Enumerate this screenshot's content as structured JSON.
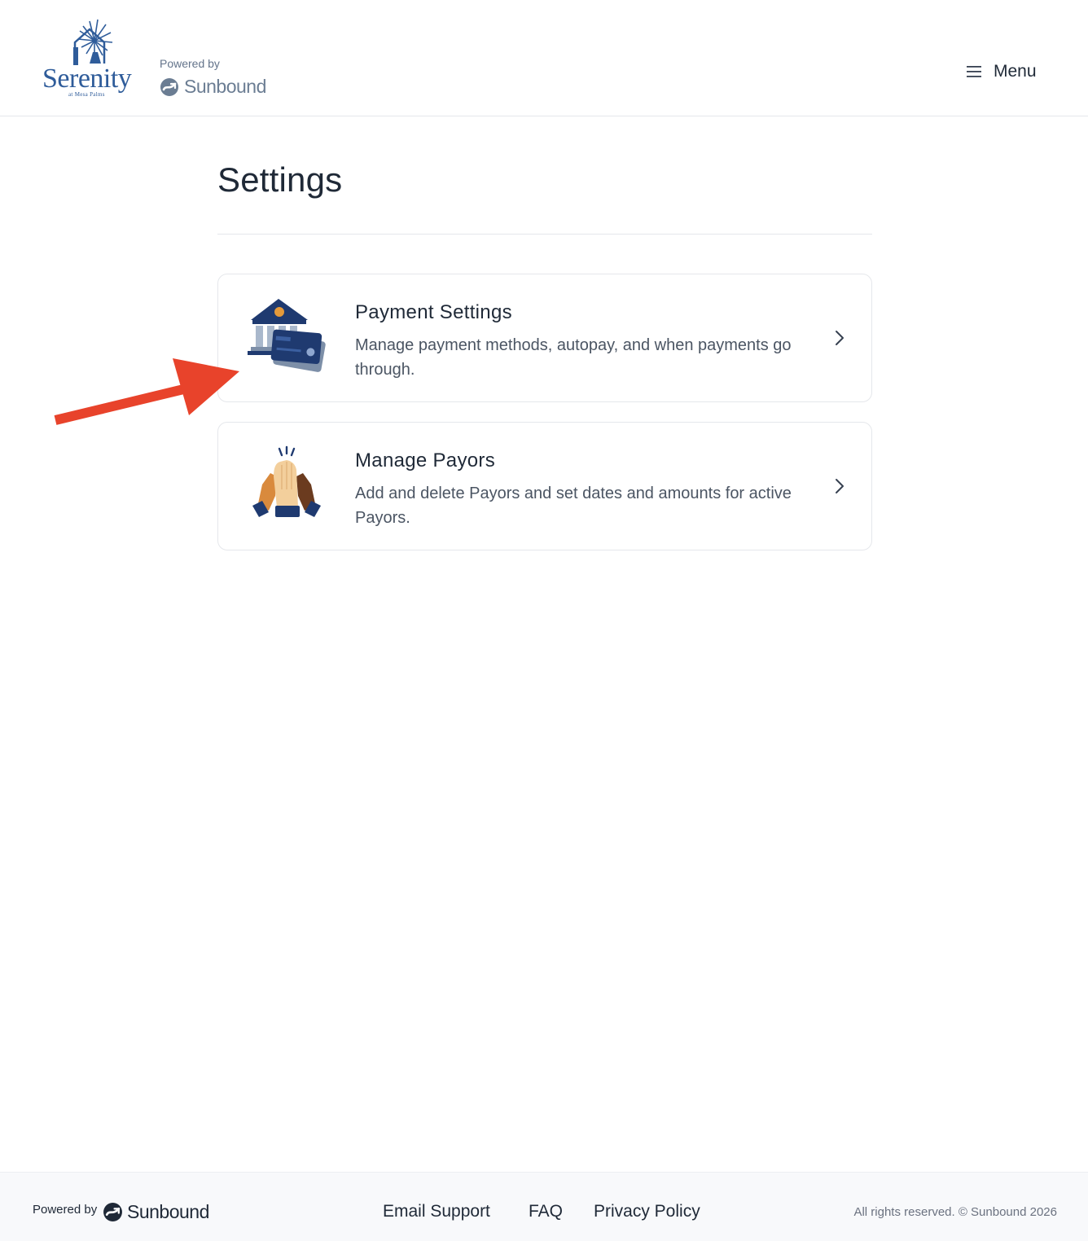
{
  "header": {
    "brand_name": "Serenity",
    "brand_subtitle": "at Mesa Palms",
    "powered_by": "Powered by",
    "platform_name": "Sunbound",
    "menu_label": "Menu"
  },
  "main": {
    "title": "Settings",
    "cards": [
      {
        "icon": "bank-card-icon",
        "title": "Payment Settings",
        "description": "Manage payment methods, autopay, and when payments go through."
      },
      {
        "icon": "high-five-icon",
        "title": "Manage Payors",
        "description": "Add and delete Payors and set dates and amounts for active Payors."
      }
    ]
  },
  "footer": {
    "powered_by": "Powered by",
    "platform_name": "Sunbound",
    "links": [
      "Email Support",
      "FAQ",
      "Privacy Policy"
    ],
    "copyright": "All rights reserved. © Sunbound 2026"
  },
  "colors": {
    "brand_blue": "#2f5c9a",
    "text_dark": "#1f2937",
    "annotation_red": "#e8432b",
    "navy": "#1f3a70"
  }
}
